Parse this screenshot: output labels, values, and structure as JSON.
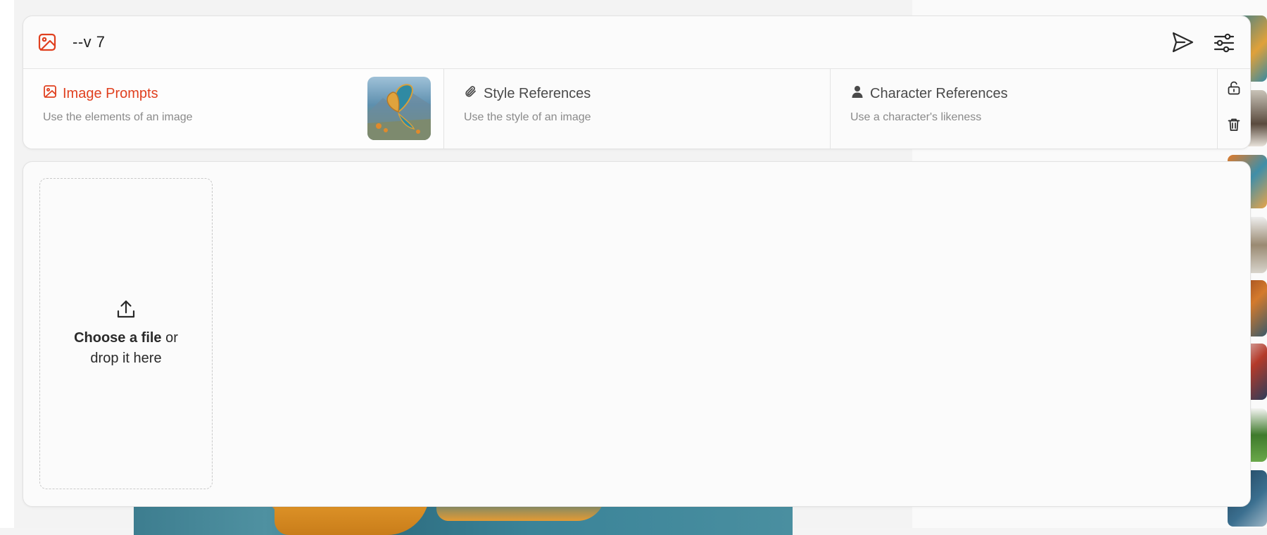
{
  "prompt": {
    "text": "--v 7"
  },
  "tabs": [
    {
      "title": "Image Prompts",
      "description": "Use the elements of an image",
      "active": true
    },
    {
      "title": "Style References",
      "description": "Use the style of an image",
      "active": false
    },
    {
      "title": "Character References",
      "description": "Use a character's likeness",
      "active": false
    }
  ],
  "upload": {
    "choose_label": "Choose a file",
    "or_label": " or",
    "drop_label": "drop it here"
  },
  "colors": {
    "accent": "#e0401f",
    "muted_text": "#8a8a8a",
    "card_bg": "#fbfbfb",
    "border": "#e2e2e2"
  },
  "icons": {
    "prompt": "image-icon",
    "send": "send-icon",
    "settings": "sliders-icon",
    "image_prompts": "image-icon",
    "style_references": "paperclip-icon",
    "character_references": "person-icon",
    "unlock": "unlock-icon",
    "delete": "trash-icon",
    "upload": "upload-icon"
  }
}
